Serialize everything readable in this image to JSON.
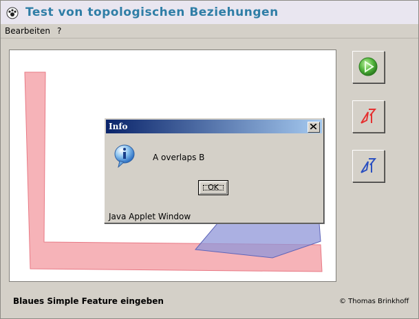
{
  "app": {
    "title": "Test von topologischen Beziehungen",
    "logo_icon": "paw-logo-icon"
  },
  "menu": {
    "items": [
      {
        "label": "Bearbeiten"
      },
      {
        "label": "?"
      }
    ]
  },
  "toolbar": {
    "buttons": [
      {
        "icon": "play-icon",
        "color": "#3aa53a"
      },
      {
        "icon": "draw-polygon-red-icon",
        "color": "#e53030"
      },
      {
        "icon": "draw-polygon-blue-icon",
        "color": "#2a4fc0"
      }
    ]
  },
  "canvas": {
    "feature_a_color": "#f4a6ab",
    "feature_b_color": "#8f96d8"
  },
  "dialog": {
    "title": "Info",
    "message": "A overlaps B",
    "ok_label": "OK",
    "footer": "Java Applet Window",
    "icon": "info-icon"
  },
  "status": {
    "text": "Blaues Simple Feature eingeben",
    "copyright": "© Thomas Brinkhoff"
  }
}
